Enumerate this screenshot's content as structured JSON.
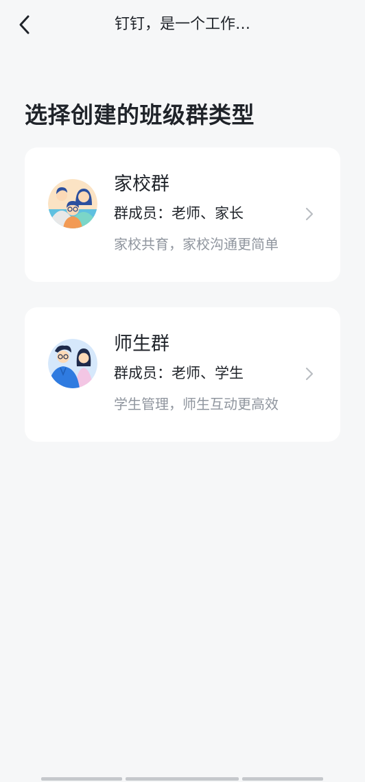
{
  "header": {
    "title": "钉钉，是一个工作…",
    "back_icon": "chevron-left-icon"
  },
  "heading": "选择创建的班级群类型",
  "options": [
    {
      "title": "家校群",
      "members": "群成员：老师、家长",
      "description": "家校共育，家校沟通更简单",
      "icon": "family-group-avatar-icon"
    },
    {
      "title": "师生群",
      "members": "群成员：老师、学生",
      "description": "学生管理，师生互动更高效",
      "icon": "teacher-student-avatar-icon"
    }
  ],
  "colors": {
    "background": "#f6f7f8",
    "card": "#ffffff",
    "text_primary": "#1f2329",
    "text_secondary": "#8f959e"
  }
}
